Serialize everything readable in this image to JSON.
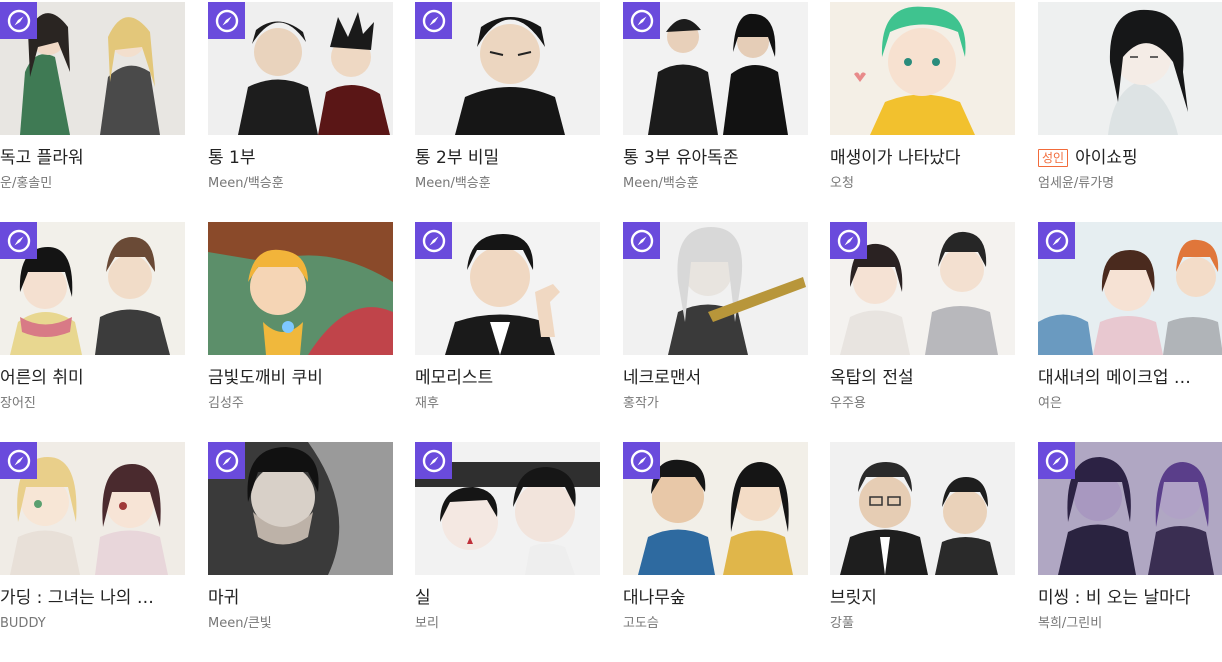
{
  "colors": {
    "badge_bg": "#6a4bdc",
    "adult_badge": "#f26b3a",
    "title_text": "#222222",
    "author_text": "#777777"
  },
  "badge_icon": "compass-icon",
  "rows": [
    [
      {
        "title": "독고 플라워",
        "author": "운/홍솔민",
        "badge": true,
        "adult": false
      },
      {
        "title": "통 1부",
        "author": "Meen/백승훈",
        "badge": true,
        "adult": false
      },
      {
        "title": "통 2부 비밀",
        "author": "Meen/백승훈",
        "badge": true,
        "adult": false
      },
      {
        "title": "통 3부 유아독존",
        "author": "Meen/백승훈",
        "badge": true,
        "adult": false
      },
      {
        "title": "매생이가 나타났다",
        "author": "오청",
        "badge": false,
        "adult": false
      },
      {
        "title": "아이쇼핑",
        "author": "엄세윤/류가명",
        "badge": false,
        "adult": true,
        "adult_label": "성인"
      }
    ],
    [
      {
        "title": "어른의 취미",
        "author": "장어진",
        "badge": true,
        "adult": false
      },
      {
        "title": "금빛도깨비 쿠비",
        "author": "김성주",
        "badge": false,
        "adult": false
      },
      {
        "title": "메모리스트",
        "author": "재후",
        "badge": true,
        "adult": false
      },
      {
        "title": "네크로맨서",
        "author": "홍작가",
        "badge": true,
        "adult": false
      },
      {
        "title": "옥탑의 전설",
        "author": "우주용",
        "badge": true,
        "adult": false
      },
      {
        "title": "대새녀의 메이크업 …",
        "author": "여은",
        "badge": true,
        "adult": false
      }
    ],
    [
      {
        "title": "가딩 : 그녀는 나의 …",
        "author": "BUDDY",
        "badge": true,
        "adult": false
      },
      {
        "title": "마귀",
        "author": "Meen/큰빛",
        "badge": true,
        "adult": false
      },
      {
        "title": "실",
        "author": "보리",
        "badge": true,
        "adult": false
      },
      {
        "title": "대나무숲",
        "author": "고도슴",
        "badge": true,
        "adult": false
      },
      {
        "title": "브릿지",
        "author": "강풀",
        "badge": false,
        "adult": false
      },
      {
        "title": "미씽 : 비 오는 날마다",
        "author": "복희/그린비",
        "badge": true,
        "adult": false
      }
    ]
  ]
}
